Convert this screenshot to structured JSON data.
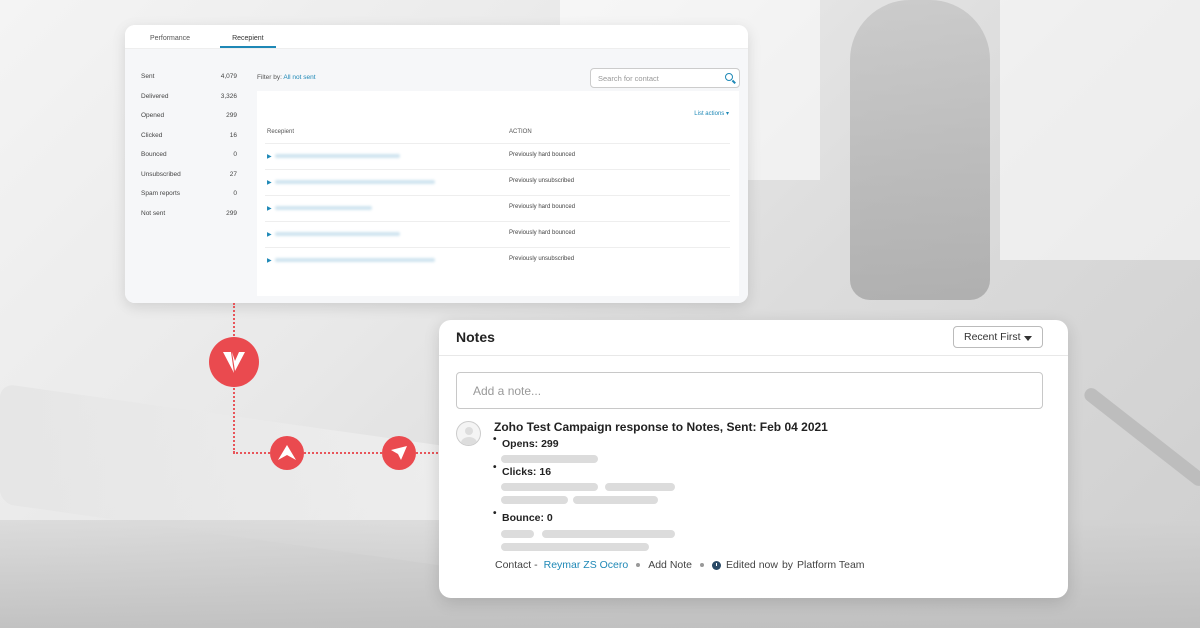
{
  "report": {
    "tabs": [
      {
        "label": "Performance"
      },
      {
        "label": "Recepient"
      }
    ],
    "stats": [
      {
        "label": "Sent",
        "value": "4,079"
      },
      {
        "label": "Delivered",
        "value": "3,326"
      },
      {
        "label": "Opened",
        "value": "299"
      },
      {
        "label": "Clicked",
        "value": "16"
      },
      {
        "label": "Bounced",
        "value": "0"
      },
      {
        "label": "Unsubscribed",
        "value": "27"
      },
      {
        "label": "Spam reports",
        "value": "0"
      },
      {
        "label": "Not sent",
        "value": "299"
      }
    ],
    "filter_prefix": "Filter by:",
    "filter_value": "All not sent",
    "search_placeholder": "Search for contact",
    "list_actions": "List actions ▾",
    "columns": {
      "recipient": "Recepient",
      "action": "ACTION"
    },
    "rows": [
      {
        "action": "Previously hard bounced"
      },
      {
        "action": "Previously unsubscribed"
      },
      {
        "action": "Previously hard bounced"
      },
      {
        "action": "Previously hard bounced"
      },
      {
        "action": "Previously unsubscribed"
      }
    ]
  },
  "notes": {
    "title": "Notes",
    "sort_label": "Recent First",
    "input_placeholder": "Add a note...",
    "note": {
      "heading": "Zoho Test Campaign response to Notes, Sent: Feb 04 2021",
      "items": [
        {
          "label": "Opens: 299"
        },
        {
          "label": "Clicks: 16"
        },
        {
          "label": "Bounce: 0"
        }
      ]
    },
    "footer": {
      "contact_label": "Contact -",
      "contact_name": "Reymar ZS Ocero",
      "add_note": "Add Note",
      "edited": "Edited now",
      "by": "by",
      "author": "Platform Team"
    }
  },
  "colors": {
    "accent": "#1e88b6",
    "brand_red": "#ea4a4f"
  }
}
